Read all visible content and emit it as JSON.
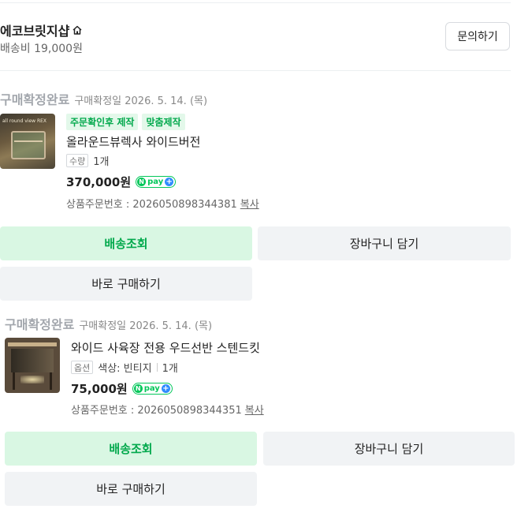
{
  "store": {
    "name": "에코브릿지샵",
    "shipping": "배송비 19,000원",
    "inquiry_label": "문의하기"
  },
  "orders": [
    {
      "status": "구매확정완료",
      "confirm_date": "구매확정일 2026. 5. 14. (목)",
      "tags": [
        "주문확인후 제작",
        "맞춤제작"
      ],
      "product_name": "올라운드뷰렉사 와이드버전",
      "option_badge": "수량",
      "option_text": "1개",
      "price": "370,000원",
      "npay_label": "pay",
      "order_no_label": "상품주문번호 : 2026050898344381",
      "copy_label": "복사",
      "thumb_text": "all round view REX",
      "buttons": {
        "track": "배송조회",
        "cart": "장바구니 담기",
        "buy_again": "바로 구매하기"
      }
    },
    {
      "status": "구매확정완료",
      "confirm_date": "구매확정일 2026. 5. 14. (목)",
      "tags": [],
      "product_name": "와이드 사육장 전용 우드선반 스텐드킷",
      "option_badge": "옵션",
      "option_text": "색상: 빈티지",
      "option_qty": "1개",
      "price": "75,000원",
      "npay_label": "pay",
      "order_no_label": "상품주문번호 : 2026050898344351",
      "copy_label": "복사",
      "buttons": {
        "track": "배송조회",
        "cart": "장바구니 담기",
        "buy_again": "바로 구매하기"
      }
    }
  ],
  "colors": {
    "accent_green": "#03a94d",
    "status_gray": "#a3a7ad",
    "button_gray": "#f1f3f5",
    "button_green": "#d9f7e3"
  }
}
